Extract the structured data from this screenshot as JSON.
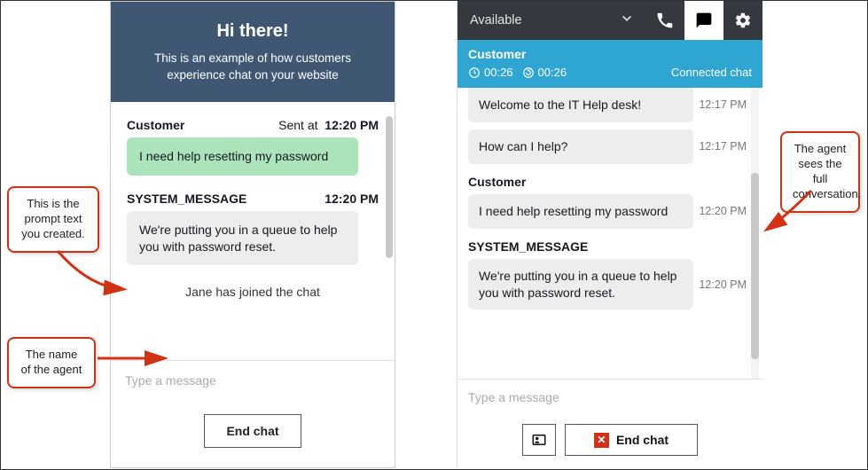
{
  "customer": {
    "header_title": "Hi there!",
    "header_sub": "This is an example of how customers experience chat on your website",
    "m1_sender": "Customer",
    "m1_sent_label": "Sent at",
    "m1_time": "12:20 PM",
    "m1_text": "I need help resetting my password",
    "m2_sender": "SYSTEM_MESSAGE",
    "m2_time": "12:20 PM",
    "m2_text": "We're putting you in a queue to help you with password reset.",
    "join_text": "Jane has joined the chat",
    "input_placeholder": "Type a message",
    "end_label": "End chat"
  },
  "agent": {
    "status": "Available",
    "contact_name": "Customer",
    "t1": "00:26",
    "t2": "00:26",
    "conn_label": "Connected chat",
    "a1_text": "Welcome to the IT Help desk!",
    "a1_time": "12:17 PM",
    "a2_text": "How can I help?",
    "a2_time": "12:17 PM",
    "a3_sender": "Customer",
    "a3_text": "I need help resetting my password",
    "a3_time": "12:20 PM",
    "a4_sender": "SYSTEM_MESSAGE",
    "a4_text": "We're putting you in a queue to help you with password reset.",
    "a4_time": "12:20 PM",
    "input_placeholder": "Type a message",
    "end_label": "End chat"
  },
  "callouts": {
    "c1": "This is the prompt text you created.",
    "c2": "The name of the agent",
    "c3": "The agent sees the full conversation."
  }
}
